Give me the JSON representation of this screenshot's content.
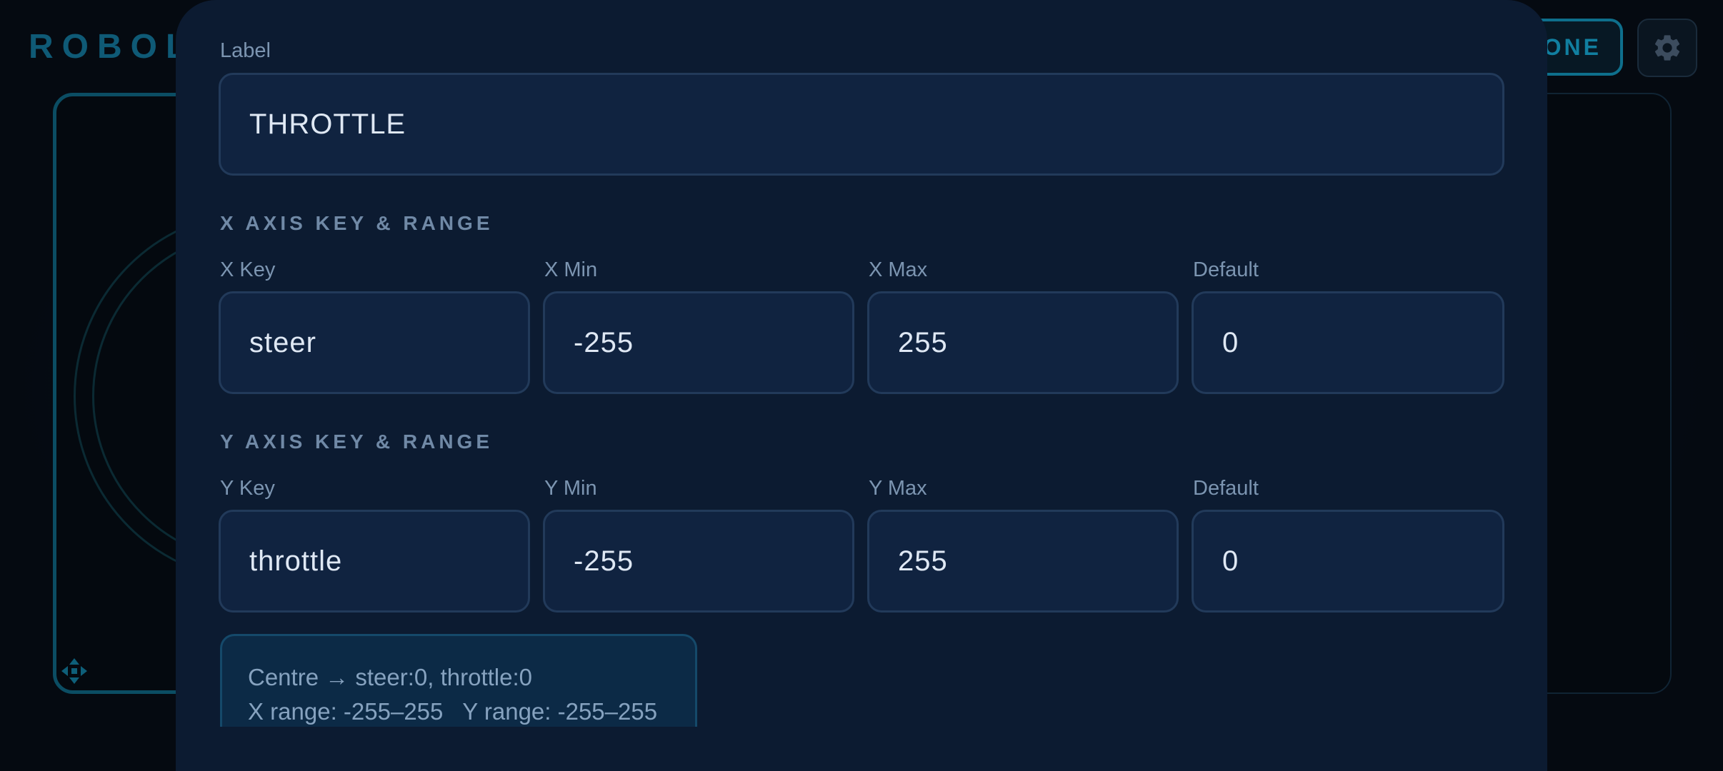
{
  "background": {
    "brand_visible": "ROBOLI",
    "done_button_visible": "ONE",
    "settings_icon": "gear-icon",
    "move_icon": "move-arrows-icon"
  },
  "modal": {
    "label": {
      "title": "Label",
      "value": "THROTTLE"
    },
    "x_axis": {
      "section_title": "X AXIS KEY & RANGE",
      "key": {
        "title": "X Key",
        "value": "steer"
      },
      "min": {
        "title": "X Min",
        "value": "-255"
      },
      "max": {
        "title": "X Max",
        "value": "255"
      },
      "default": {
        "title": "Default",
        "value": "0"
      }
    },
    "y_axis": {
      "section_title": "Y AXIS KEY & RANGE",
      "key": {
        "title": "Y Key",
        "value": "throttle"
      },
      "min": {
        "title": "Y Min",
        "value": "-255"
      },
      "max": {
        "title": "Y Max",
        "value": "255"
      },
      "default": {
        "title": "Default",
        "value": "0"
      }
    },
    "summary": {
      "line1": "Centre → steer:0, throttle:0",
      "line2": "X range: -255–255   Y range: -255–255"
    }
  },
  "colors": {
    "modal_bg": "#0c1b31",
    "input_bg": "#102340",
    "input_border": "#223a5a",
    "accent": "#117fa0"
  }
}
